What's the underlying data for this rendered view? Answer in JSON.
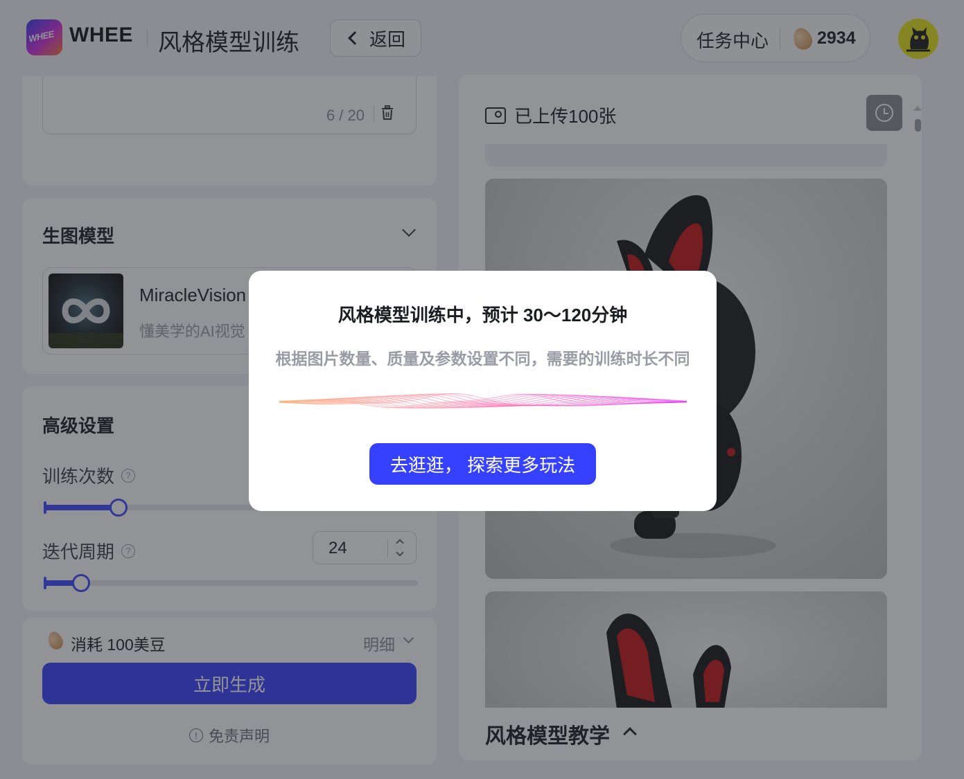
{
  "header": {
    "brand": "WHEE",
    "logo_text": "WHEE",
    "page_title": "风格模型训练",
    "back_label": "返回",
    "task_center": "任务中心",
    "bean_count": "2934"
  },
  "description": {
    "counter": "6 / 20"
  },
  "model_section": {
    "title": "生图模型",
    "model_name": "MiracleVision",
    "model_desc": "懂美学的AI视觉"
  },
  "advanced": {
    "title": "高级设置",
    "train_count_label": "训练次数",
    "train_count_fraction": 0.2,
    "epoch_label": "迭代周期",
    "epoch_value": "24",
    "epoch_fraction": 0.1
  },
  "generate": {
    "cost_text": "消耗 100美豆",
    "detail_label": "明细",
    "button_label": "立即生成",
    "disclaimer": "免责声明"
  },
  "uploads": {
    "title": "已上传100张"
  },
  "tutorial": {
    "title": "风格模型教学"
  },
  "modal": {
    "title": "风格模型训练中，预计 30～120分钟",
    "subtitle": "根据图片数量、质量及参数设置不同，需要的训练时长不同",
    "button_label": "去逛逛， 探索更多玩法"
  },
  "colors": {
    "accent": "#3641ff",
    "wave_start": "#ffb27a",
    "wave_mid": "#ff6fa8",
    "wave_end": "#e63cf0"
  }
}
